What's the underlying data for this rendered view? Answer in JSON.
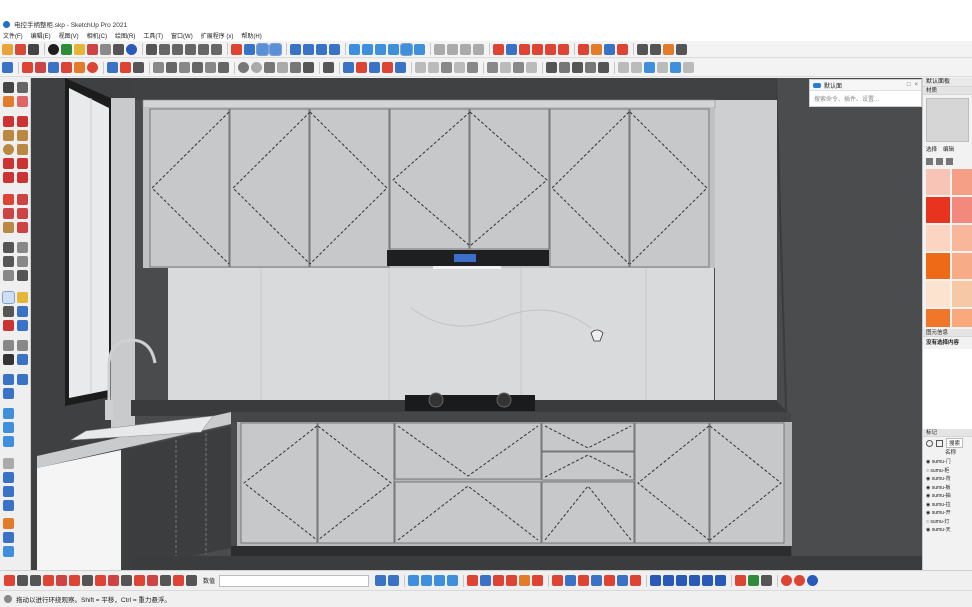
{
  "window": {
    "title": "电控手柄整柜.skp - SketchUp Pro 2021"
  },
  "menu": {
    "items": [
      "文件(F)",
      "编辑(E)",
      "视图(V)",
      "相机(C)",
      "绘图(R)",
      "工具(T)",
      "窗口(W)",
      "扩展程序 (x)",
      "帮助(H)"
    ]
  },
  "tray_search": {
    "title": "默认面",
    "placeholder": "搜索命令、插件、设置..."
  },
  "right_panel": {
    "header": "默认面板",
    "materials_section": "材质",
    "tabs": [
      "选择",
      "编辑"
    ],
    "entity_info_section": "图元信息",
    "entity_info_text": "没有选择内容",
    "tags_section": "标记",
    "tags_search_label": "搜索",
    "tags_column_name": "名称",
    "tags": [
      "sumu-门",
      "sumu-柜",
      "sumu-背",
      "sumu-板",
      "sumu-抽",
      "sumu-拉",
      "sumu-开",
      "sumu-灯",
      "sumu-天"
    ],
    "swatch_colors": [
      "#f7c4b5",
      "#f59f86",
      "#e8331f",
      "#f2897c",
      "#fcd4c2",
      "#f8b79a",
      "#ee6a16",
      "#f7ab86",
      "#fbe3cf",
      "#f6c8a6",
      "#f0772a",
      "#f9a97c"
    ]
  },
  "bottom_toolbar": {
    "measurements_label": "数值"
  },
  "status": {
    "hint": "拖动以进行环绕观察。Shift = 平移，Ctrl = 重力悬浮。"
  },
  "colors": {
    "viewport_bg": "#494b4d",
    "accent_blue": "#2a7bd6",
    "selected_tool": "#cfe0f5"
  }
}
